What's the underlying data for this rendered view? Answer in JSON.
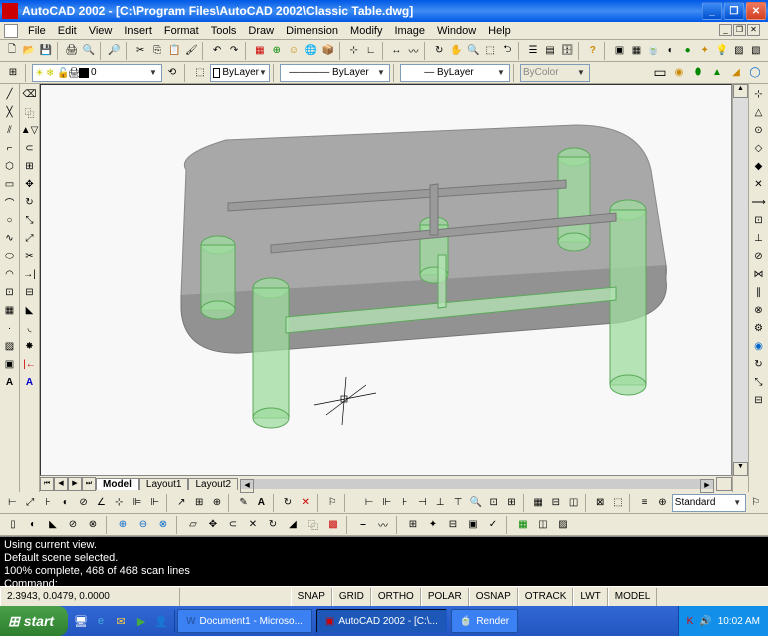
{
  "window": {
    "title": "AutoCAD 2002 - [C:\\Program Files\\AutoCAD 2002\\Classic Table.dwg]"
  },
  "menu": [
    "File",
    "Edit",
    "View",
    "Insert",
    "Format",
    "Tools",
    "Draw",
    "Dimension",
    "Modify",
    "Image",
    "Window",
    "Help"
  ],
  "layer": {
    "current": "0",
    "linetype": "ByLayer",
    "lineweight": "ByLayer",
    "color": "ByLayer",
    "plotcolor": "ByColor"
  },
  "textstyle": {
    "current": "Standard"
  },
  "tabs": {
    "model": "Model",
    "layout1": "Layout1",
    "layout2": "Layout2"
  },
  "command_output": "Using current view.\nDefault scene selected.\n100% complete, 468 of 468 scan lines\nCommand:",
  "status": {
    "coords": "2.3943, 0.0479, 0.0000",
    "toggles": [
      "SNAP",
      "GRID",
      "ORTHO",
      "POLAR",
      "OSNAP",
      "OTRACK",
      "LWT",
      "MODEL"
    ]
  },
  "taskbar": {
    "start": "start",
    "items": [
      {
        "label": "Document1 - Microso...",
        "active": false
      },
      {
        "label": "AutoCAD 2002 - [C:\\...",
        "active": true
      },
      {
        "label": "Render",
        "active": false
      }
    ],
    "clock": "10:02 AM"
  }
}
